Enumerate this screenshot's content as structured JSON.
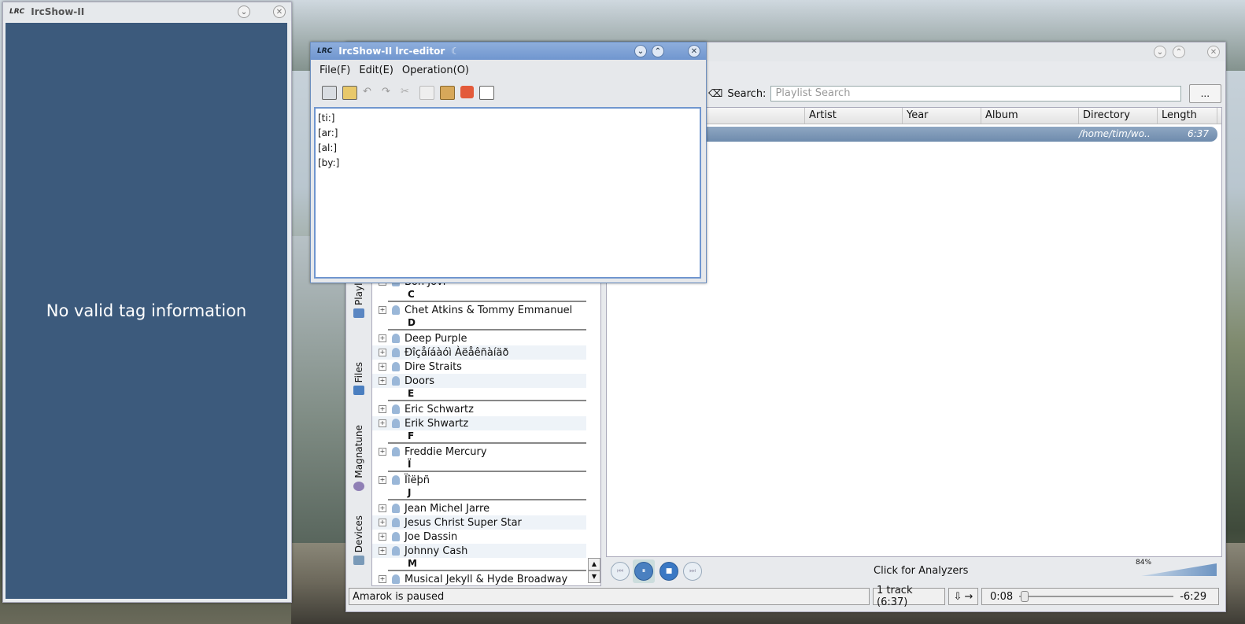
{
  "lyric_window": {
    "title": "IrcShow-II",
    "message": "No valid tag information",
    "logo_text": "LRC"
  },
  "editor_window": {
    "title": "IrcShow-II lrc-editor",
    "logo_text": "LRC",
    "menu": [
      "File(F)",
      "Edit(E)",
      "Operation(O)"
    ],
    "toolbar_icons": [
      "save-icon",
      "save-as-icon",
      "undo-icon",
      "redo-icon",
      "cut-icon",
      "copy-icon",
      "paste-icon",
      "erase-icon",
      "edit-icon"
    ],
    "text_lines": [
      "[ti:]",
      "[ar:]",
      "[al:]",
      "[by:]"
    ],
    "accent_color": "#7096cf"
  },
  "amarok": {
    "search": {
      "label": "Search:",
      "placeholder": "Playlist Search",
      "more_button": "..."
    },
    "playlist": {
      "columns": [
        "Artist",
        "Year",
        "Album",
        "Directory",
        "Length"
      ],
      "rows": [
        {
          "directory": "/home/tim/wo..",
          "length": "6:37"
        }
      ]
    },
    "browser_tabs": [
      "Playlis",
      "Files",
      "Magnatune",
      "Devices"
    ],
    "collection": [
      {
        "type": "artist",
        "name": "Bon Jovi"
      },
      {
        "type": "letter",
        "name": "C"
      },
      {
        "type": "artist",
        "name": "Chet Atkins & Tommy Emmanuel"
      },
      {
        "type": "letter",
        "name": "D"
      },
      {
        "type": "artist",
        "name": "Deep Purple"
      },
      {
        "type": "artist",
        "name": "Ðîçåíáàóì Àëåêñàíäð"
      },
      {
        "type": "artist",
        "name": "Dire Straits"
      },
      {
        "type": "artist",
        "name": "Doors"
      },
      {
        "type": "letter",
        "name": "E"
      },
      {
        "type": "artist",
        "name": "Eric Schwartz"
      },
      {
        "type": "artist",
        "name": "Erik Shwartz"
      },
      {
        "type": "letter",
        "name": "F"
      },
      {
        "type": "artist",
        "name": "Freddie Mercury"
      },
      {
        "type": "letter",
        "name": "Ï"
      },
      {
        "type": "artist",
        "name": "Ïîëþñ"
      },
      {
        "type": "letter",
        "name": "J"
      },
      {
        "type": "artist",
        "name": "Jean Michel Jarre"
      },
      {
        "type": "artist",
        "name": "Jesus Christ Super Star"
      },
      {
        "type": "artist",
        "name": "Joe Dassin"
      },
      {
        "type": "artist",
        "name": "Johnny Cash"
      },
      {
        "type": "letter",
        "name": "M"
      },
      {
        "type": "artist",
        "name": "Musical Jekyll & Hyde Broadway"
      }
    ],
    "controls": {
      "analyzers": "Click for Analyzers",
      "volume_label": "84%",
      "volume": 0.84
    },
    "status": {
      "message": "Amarok is paused",
      "track_count": "1 track (6:37)",
      "elapsed": "0:08",
      "remaining": "-6:29",
      "progress": 0.02
    }
  }
}
